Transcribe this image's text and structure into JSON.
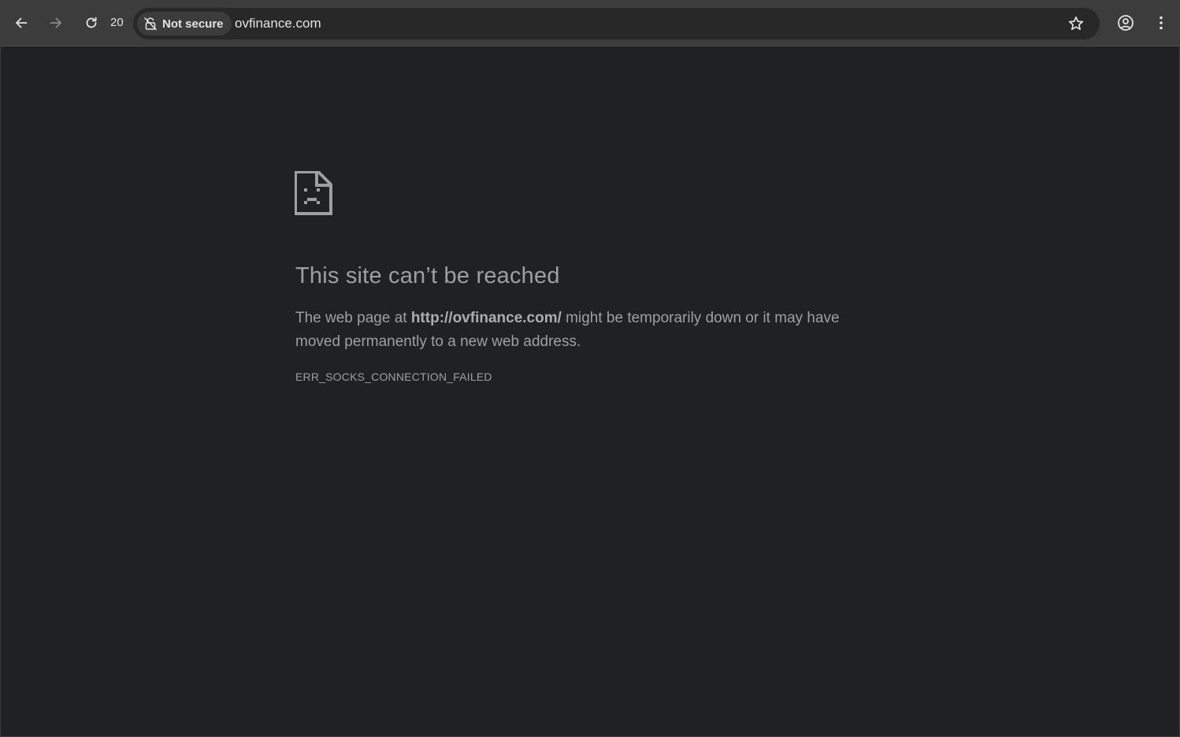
{
  "toolbar": {
    "reload_count": "20",
    "security_label": "Not secure",
    "url": "ovfinance.com",
    "icons": [
      "back-arrow-icon",
      "forward-arrow-icon",
      "reload-icon",
      "not-secure-icon",
      "star-icon",
      "profile-icon",
      "kebab-menu-icon"
    ]
  },
  "error": {
    "title": "This site can’t be reached",
    "desc_prefix": "The web page at ",
    "desc_url": "http://ovfinance.com/",
    "desc_suffix": " might be temporarily down or it may have moved permanently to a new web address.",
    "code": "ERR_SOCKS_CONNECTION_FAILED",
    "icon": "sad-page-icon"
  },
  "colors": {
    "toolbar_bg": "#3c3c3c",
    "omnibox_bg": "#282828",
    "page_bg": "#202124",
    "text_secondary": "#9aa0a6"
  }
}
